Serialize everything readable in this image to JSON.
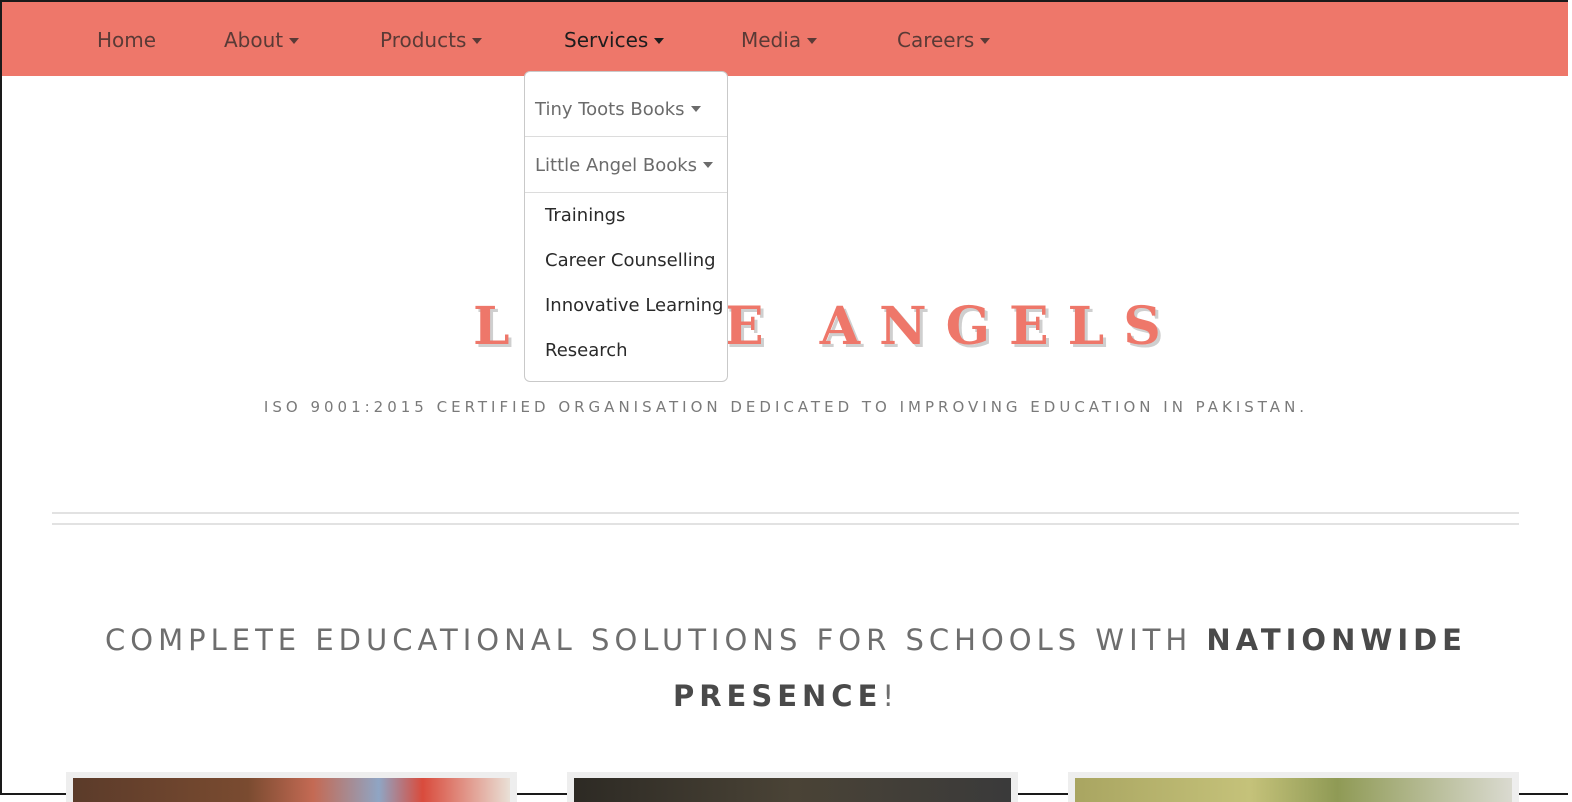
{
  "nav": {
    "items": [
      {
        "label": "Home",
        "has_caret": false
      },
      {
        "label": "About",
        "has_caret": true
      },
      {
        "label": "Products",
        "has_caret": true
      },
      {
        "label": "Services",
        "has_caret": true,
        "active": true
      },
      {
        "label": "Media",
        "has_caret": true
      },
      {
        "label": "Careers",
        "has_caret": true
      }
    ]
  },
  "services_dropdown": {
    "submenus": [
      "Tiny Toots Books",
      "Little Angel Books"
    ],
    "items": [
      "Trainings",
      "Career Counselling",
      "Innovative Learning",
      "Research"
    ]
  },
  "hero": {
    "brand_left": "L",
    "brand_right": "E ANGELS",
    "tagline": "ISO 9001:2015 CERTIFIED ORGANISATION DEDICATED TO IMPROVING EDUCATION IN PAKISTAN."
  },
  "headline": {
    "prefix": "COMPLETE EDUCATIONAL SOLUTIONS FOR SCHOOLS WITH ",
    "bold1": "NATIONWIDE",
    "bold2": "PRESENCE",
    "suffix": "!"
  },
  "colors": {
    "accent": "#ee776a",
    "nav_text": "#5a3a36"
  }
}
